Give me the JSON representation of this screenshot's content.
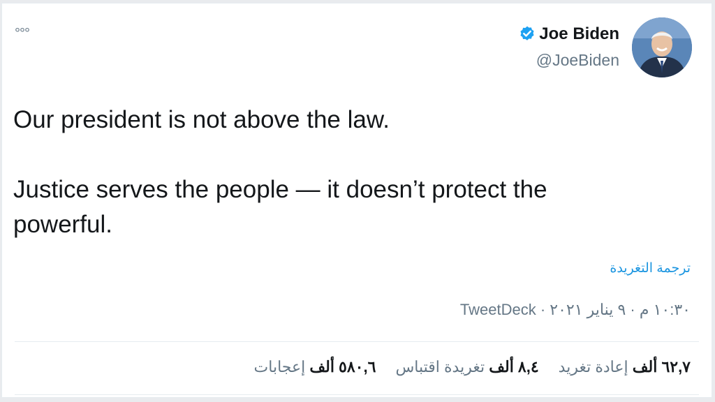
{
  "author": {
    "name": "Joe Biden",
    "handle": "@JoeBiden",
    "verified": true
  },
  "menu": {
    "more_icon": "more-dots-icon",
    "glyph": "°°°"
  },
  "tweet": {
    "text": "Our president is not above the law.\n\nJustice serves the people — it doesn’t protect the powerful.",
    "translate_label": "ترجمة التغريدة"
  },
  "meta": {
    "time": "١٠:٣٠ م",
    "date": "٩ يناير ٢٠٢١",
    "separator": " · ",
    "source": "TweetDeck"
  },
  "stats": [
    {
      "count": "٦٢,٧ ألف",
      "label": "إعادة تغريد"
    },
    {
      "count": "٨,٤ ألف",
      "label": "تغريدة اقتباس"
    },
    {
      "count": "٥٨٠,٦ ألف",
      "label": "إعجابات"
    }
  ],
  "colors": {
    "text": "#14171a",
    "secondary": "#657786",
    "link": "#1b95e0",
    "verified_badge": "#1da1f2"
  }
}
